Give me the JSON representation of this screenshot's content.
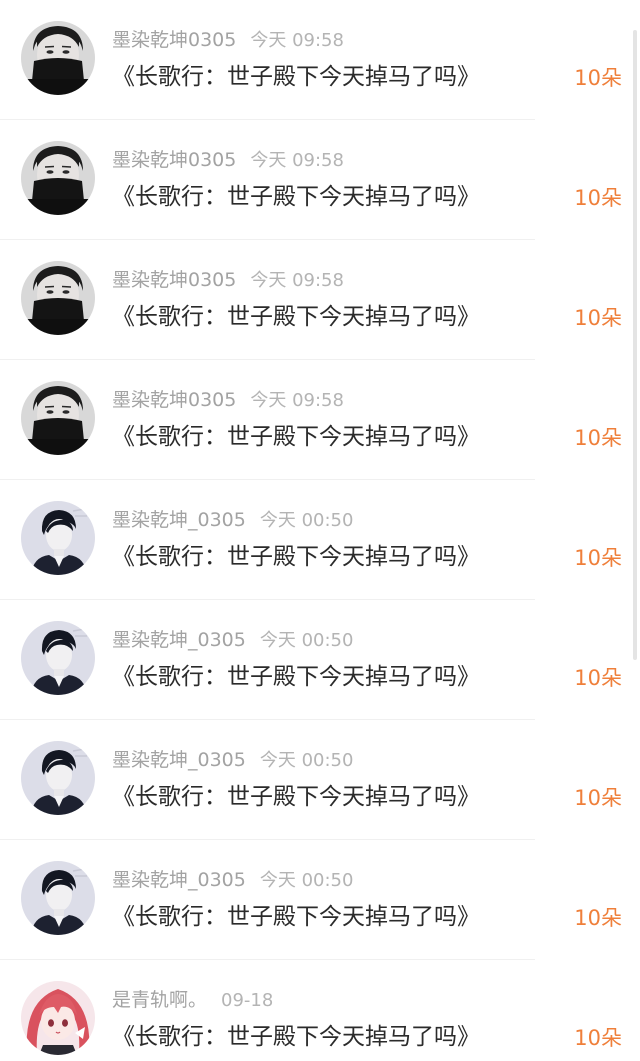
{
  "colors": {
    "gift": "#ef7f3a",
    "username": "#a3a3a3",
    "title": "#2b2b2b",
    "divider": "#f0f0f0"
  },
  "rows": [
    {
      "username": "墨染乾坤0305",
      "time": "今天 09:58",
      "title": "《长歌行：世子殿下今天掉马了吗》",
      "gift": "10朵",
      "avatar": "masked-man-avatar"
    },
    {
      "username": "墨染乾坤0305",
      "time": "今天 09:58",
      "title": "《长歌行：世子殿下今天掉马了吗》",
      "gift": "10朵",
      "avatar": "masked-man-avatar"
    },
    {
      "username": "墨染乾坤0305",
      "time": "今天 09:58",
      "title": "《长歌行：世子殿下今天掉马了吗》",
      "gift": "10朵",
      "avatar": "masked-man-avatar"
    },
    {
      "username": "墨染乾坤0305",
      "time": "今天 09:58",
      "title": "《长歌行：世子殿下今天掉马了吗》",
      "gift": "10朵",
      "avatar": "masked-man-avatar"
    },
    {
      "username": "墨染乾坤_0305",
      "time": "今天 00:50",
      "title": "《长歌行：世子殿下今天掉马了吗》",
      "gift": "10朵",
      "avatar": "suit-man-avatar"
    },
    {
      "username": "墨染乾坤_0305",
      "time": "今天 00:50",
      "title": "《长歌行：世子殿下今天掉马了吗》",
      "gift": "10朵",
      "avatar": "suit-man-avatar"
    },
    {
      "username": "墨染乾坤_0305",
      "time": "今天 00:50",
      "title": "《长歌行：世子殿下今天掉马了吗》",
      "gift": "10朵",
      "avatar": "suit-man-avatar"
    },
    {
      "username": "墨染乾坤_0305",
      "time": "今天 00:50",
      "title": "《长歌行：世子殿下今天掉马了吗》",
      "gift": "10朵",
      "avatar": "suit-man-avatar"
    },
    {
      "username": "是青轨啊。",
      "time": "09-18",
      "title": "《长歌行：世子殿下今天掉马了吗》",
      "gift": "10朵",
      "avatar": "anime-girl-avatar"
    }
  ]
}
